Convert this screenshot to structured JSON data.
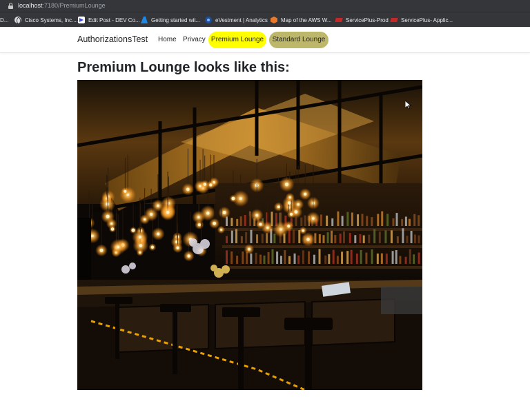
{
  "browser": {
    "url_host": "localhost",
    "url_path": ":7180/PremiumLounge",
    "bookmarks": [
      {
        "label": "D...",
        "icon": "none"
      },
      {
        "label": "Cisco Systems, Inc....",
        "icon": "globe-icon"
      },
      {
        "label": "Edit Post - DEV Co...",
        "icon": "dev-icon"
      },
      {
        "label": "Getting started wit...",
        "icon": "azure-icon"
      },
      {
        "label": "eVestment | Analytics",
        "icon": "evestment-icon"
      },
      {
        "label": "Map of the AWS W...",
        "icon": "aws-icon"
      },
      {
        "label": "ServicePlus-Prod",
        "icon": "serviceplus-icon"
      },
      {
        "label": "ServicePlus- Applic...",
        "icon": "serviceplus-icon"
      }
    ]
  },
  "nav": {
    "brand": "AuthorizationsTest",
    "home": "Home",
    "privacy": "Privacy",
    "premium": "Premium Lounge",
    "standard": "Standard Lounge"
  },
  "colors": {
    "premium_pill": "#ffff00",
    "standard_pill": "#bdb76b"
  },
  "main": {
    "title": "Premium Lounge looks like this:"
  }
}
